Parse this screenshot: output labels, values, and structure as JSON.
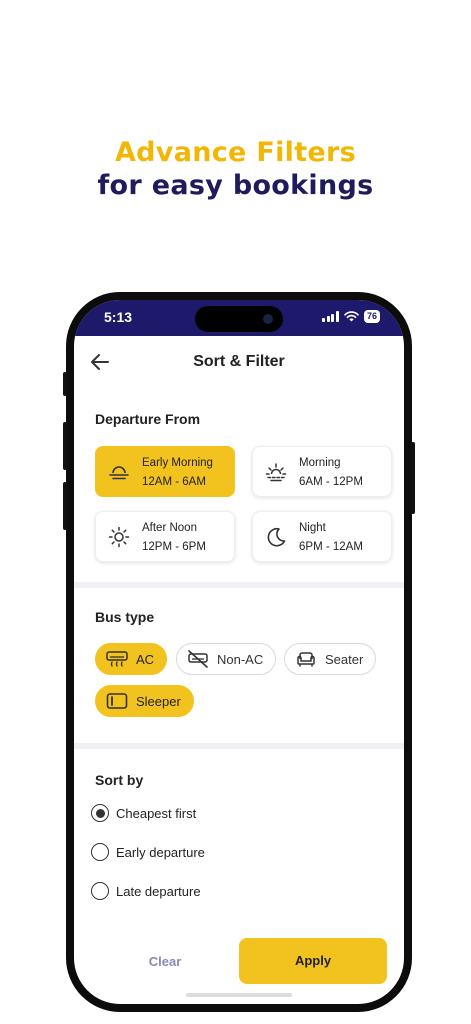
{
  "headline": {
    "line1": "Advance Filters",
    "line2": "for easy bookings"
  },
  "colors": {
    "accent": "#F2C21E",
    "headline_yellow": "#F2B705",
    "navy": "#1E1A6B",
    "clear_text": "#8A88B8"
  },
  "status_bar": {
    "time": "5:13",
    "battery": "76"
  },
  "header": {
    "title": "Sort & Filter",
    "back_icon": "arrow-left-icon"
  },
  "departure": {
    "title": "Departure From",
    "options": [
      {
        "label": "Early Morning",
        "range": "12AM - 6AM",
        "icon": "sunrise-icon",
        "selected": true
      },
      {
        "label": "Morning",
        "range": "6AM - 12PM",
        "icon": "sun-rising-icon",
        "selected": false
      },
      {
        "label": "After Noon",
        "range": "12PM - 6PM",
        "icon": "sun-icon",
        "selected": false
      },
      {
        "label": "Night",
        "range": "6PM - 12AM",
        "icon": "moon-icon",
        "selected": false
      }
    ]
  },
  "bus_type": {
    "title": "Bus type",
    "options": [
      {
        "label": "AC",
        "icon": "ac-icon",
        "selected": true
      },
      {
        "label": "Non-AC",
        "icon": "non-ac-icon",
        "selected": false
      },
      {
        "label": "Seater",
        "icon": "seat-icon",
        "selected": false
      },
      {
        "label": "Sleeper",
        "icon": "sleeper-icon",
        "selected": true
      }
    ]
  },
  "sort_by": {
    "title": "Sort by",
    "options": [
      {
        "label": "Cheapest first",
        "selected": true
      },
      {
        "label": "Early departure",
        "selected": false
      },
      {
        "label": "Late departure",
        "selected": false
      }
    ]
  },
  "actions": {
    "clear": "Clear",
    "apply": "Apply"
  }
}
